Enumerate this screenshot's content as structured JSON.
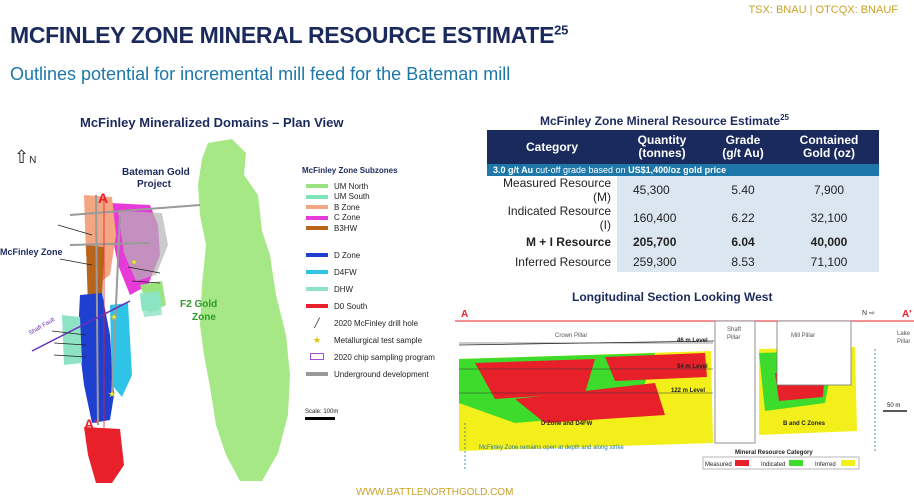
{
  "header": {
    "ticker": "TSX: BNAU | OTCQX: BNAUF",
    "title": "MCFINLEY ZONE MINERAL RESOURCE ESTIMATE",
    "title_sup": "25",
    "subtitle": "Outlines potential for incremental mill feed for the Bateman mill"
  },
  "plan_view": {
    "heading": "McFinley Mineralized Domains – Plan View",
    "north": "N",
    "labels": {
      "bateman_line1": "Bateman Gold",
      "bateman_line2": "Project",
      "mcfinley_zone": "McFinley Zone",
      "f2_line1": "F2 Gold",
      "f2_line2": "Zone",
      "section_a_top": "A",
      "section_a_bottom": "A'",
      "shaft_fault": "Shaft Fault"
    },
    "legend_title": "McFinley Zone Subzones",
    "legend": [
      {
        "label": "UM North",
        "color": "#9be37f"
      },
      {
        "label": "UM South",
        "color": "#7fe3b8"
      },
      {
        "label": "B Zone",
        "color": "#f4a582"
      },
      {
        "label": "C Zone",
        "color": "#e83ad8"
      },
      {
        "label": "B3HW",
        "color": "#b8651b"
      },
      {
        "label": "D Zone",
        "color": "#1f3fd1"
      },
      {
        "label": "D4FW",
        "color": "#2ec4e8"
      },
      {
        "label": "DHW",
        "color": "#8fe3c4"
      },
      {
        "label": "D0 South",
        "color": "#e8202a"
      },
      {
        "label": "2020 McFinley drill hole",
        "symbol": "line"
      },
      {
        "label": "Metallurgical test sample",
        "symbol": "star"
      },
      {
        "label": "2020 chip sampling program",
        "symbol": "box"
      },
      {
        "label": "Underground development",
        "color": "#9a9a9a"
      }
    ],
    "scale_label": "Scale: 100m"
  },
  "resource_table": {
    "heading": "McFinley Zone Mineral Resource Estimate",
    "heading_sup": "25",
    "columns": [
      "Category",
      "Quantity\n(tonnes)",
      "Grade\n(g/t Au)",
      "Contained\nGold (oz)"
    ],
    "cutoff_prefix": "3.0 g/t Au",
    "cutoff_middle": " cut-off grade based on ",
    "cutoff_suffix": "US$1,400/oz gold price",
    "rows": [
      {
        "category": "Measured Resource (M)",
        "tonnes": "45,300",
        "grade": "5.40",
        "oz": "7,900",
        "bold": false
      },
      {
        "category": "Indicated Resource (I)",
        "tonnes": "160,400",
        "grade": "6.22",
        "oz": "32,100",
        "bold": false
      },
      {
        "category": "M + I Resource",
        "tonnes": "205,700",
        "grade": "6.04",
        "oz": "40,000",
        "bold": true
      },
      {
        "category": "Inferred Resource",
        "tonnes": "259,300",
        "grade": "8.53",
        "oz": "71,100",
        "bold": false
      }
    ]
  },
  "long_section": {
    "heading": "Longitudinal Section Looking West",
    "labels": {
      "a_left": "A",
      "a_right": "A'",
      "n_arrow": "N",
      "crown_pillar": "Crown Pillar",
      "shaft_pillar_1": "Shaft",
      "shaft_pillar_2": "Pillar",
      "mill_pillar": "Mill Pillar",
      "lake_pillar_1": "Lake",
      "lake_pillar_2": "Pillar",
      "level_46": "46 m Level",
      "level_84": "84 m Level",
      "level_122": "122 m Level",
      "d_zone": "D Zone and D4FW",
      "bc_zones": "B and C Zones",
      "scale": "50 m",
      "open_note": "McFinley Zone remains open at depth and along strike"
    },
    "legend_title": "Mineral Resource Category",
    "legend": [
      {
        "label": "Measured",
        "color": "#e8202a"
      },
      {
        "label": "Indicated",
        "color": "#3ddc2c"
      },
      {
        "label": "Inferred",
        "color": "#f2ef1a"
      }
    ]
  },
  "footer": {
    "url": "WWW.BATTLENORTHGOLD.COM"
  }
}
